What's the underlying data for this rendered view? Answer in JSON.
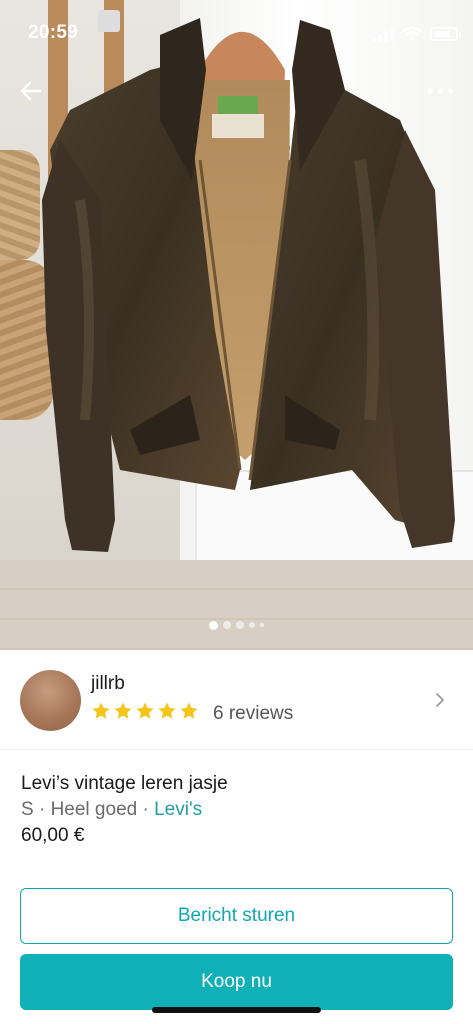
{
  "status_bar": {
    "time": "20:59"
  },
  "photo": {
    "carousel": {
      "count": 5,
      "active_index": 0
    },
    "back_icon": "arrow-left-icon",
    "more_icon": "more-horizontal-icon"
  },
  "seller": {
    "username": "jillrb",
    "rating": 5,
    "reviews_label": "6 reviews",
    "star_color": "#f5c518"
  },
  "item": {
    "title": "Levi’s vintage leren jasje",
    "size": "S",
    "separator": " · ",
    "condition": "Heel goed",
    "brand": "Levi's",
    "price": "60,00 €"
  },
  "actions": {
    "message_label": "Bericht sturen",
    "buy_label": "Koop nu"
  },
  "colors": {
    "accent": "#0fb0b8",
    "brand_link": "#1f9ea7"
  }
}
